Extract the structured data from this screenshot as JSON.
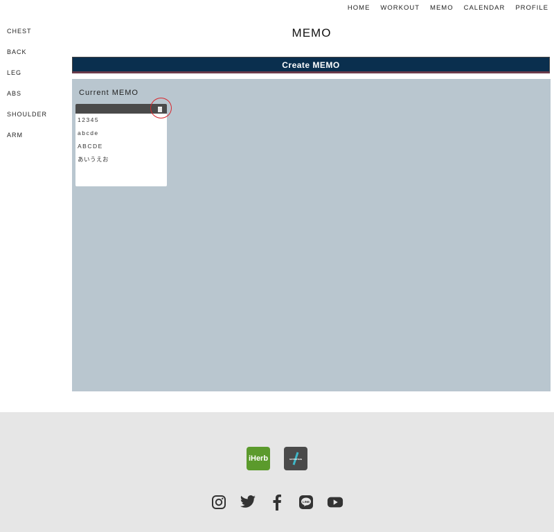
{
  "topnav": {
    "items": [
      {
        "label": "HOME"
      },
      {
        "label": "WORKOUT"
      },
      {
        "label": "MEMO"
      },
      {
        "label": "CALENDAR"
      },
      {
        "label": "PROFILE"
      }
    ]
  },
  "sidebar": {
    "items": [
      {
        "label": "CHEST"
      },
      {
        "label": "BACK"
      },
      {
        "label": "LEG"
      },
      {
        "label": "ABS"
      },
      {
        "label": "SHOULDER"
      },
      {
        "label": "ARM"
      }
    ]
  },
  "page": {
    "title": "MEMO",
    "create_button": "Create MEMO"
  },
  "memo_panel": {
    "title": "Current MEMO",
    "memos": [
      {
        "lines": [
          "12345",
          "abcde",
          "ABCDE",
          "あいうえお"
        ]
      }
    ]
  },
  "footer": {
    "partners": [
      {
        "label": "iHerb",
        "color": "#5b9a2c"
      },
      {
        "label": "MYPROTEIN",
        "color": "#4a4a4a"
      }
    ],
    "socials": [
      "instagram-icon",
      "twitter-icon",
      "facebook-icon",
      "line-icon",
      "youtube-icon"
    ]
  }
}
